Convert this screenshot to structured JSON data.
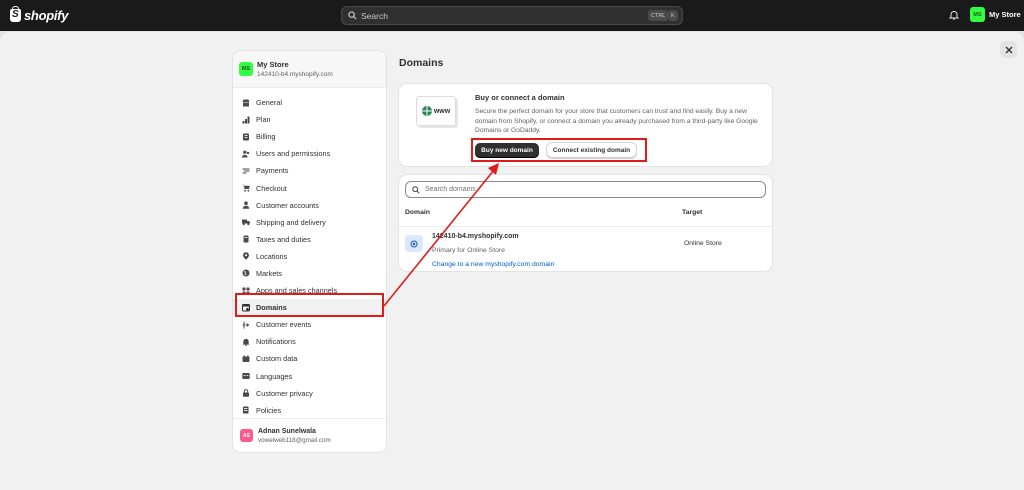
{
  "topbar": {
    "logo_text": "shopify",
    "search_placeholder": "Search",
    "kbd_ctrl": "CTRL",
    "kbd_k": "K",
    "store_initials": "MS",
    "store_label": "My Store"
  },
  "sidebar": {
    "store_initials": "MS",
    "store_name": "My Store",
    "store_url": "142410-b4.myshopify.com",
    "items": [
      {
        "label": "General",
        "icon": "store-icon"
      },
      {
        "label": "Plan",
        "icon": "chart-icon"
      },
      {
        "label": "Billing",
        "icon": "billing-icon"
      },
      {
        "label": "Users and permissions",
        "icon": "users-icon"
      },
      {
        "label": "Payments",
        "icon": "payments-icon"
      },
      {
        "label": "Checkout",
        "icon": "cart-icon"
      },
      {
        "label": "Customer accounts",
        "icon": "person-icon"
      },
      {
        "label": "Shipping and delivery",
        "icon": "truck-icon"
      },
      {
        "label": "Taxes and duties",
        "icon": "taxes-icon"
      },
      {
        "label": "Locations",
        "icon": "location-icon"
      },
      {
        "label": "Markets",
        "icon": "globe-icon"
      },
      {
        "label": "Apps and sales channels",
        "icon": "apps-icon"
      },
      {
        "label": "Domains",
        "icon": "domains-icon"
      },
      {
        "label": "Customer events",
        "icon": "events-icon"
      },
      {
        "label": "Notifications",
        "icon": "bell-icon"
      },
      {
        "label": "Custom data",
        "icon": "database-icon"
      },
      {
        "label": "Languages",
        "icon": "language-icon"
      },
      {
        "label": "Customer privacy",
        "icon": "lock-icon"
      },
      {
        "label": "Policies",
        "icon": "policy-icon"
      }
    ],
    "active_index": 12,
    "user_initials": "AS",
    "user_name": "Adnan Sunelwala",
    "user_email": "vowelweb118@gmail.com"
  },
  "main": {
    "title": "Domains",
    "buy_card": {
      "image_text": "www",
      "title": "Buy or connect a domain",
      "description": "Secure the perfect domain for your store that customers can trust and find easily. Buy a new domain from Shopify, or connect a domain you already purchased from a third-party like Google Domains or GoDaddy.",
      "buy_button": "Buy new domain",
      "connect_button": "Connect existing domain"
    },
    "table": {
      "search_placeholder": "Search domains",
      "col_domain": "Domain",
      "col_target": "Target",
      "rows": [
        {
          "domain": "142410-b4.myshopify.com",
          "subtitle": "Primary for Online Store",
          "link": "Change to a new myshopify.com domain",
          "target": "Online Store"
        }
      ]
    }
  },
  "colors": {
    "annotation": "#e01b1b",
    "link": "#005bd3",
    "store_avatar": "#36fc41",
    "user_avatar": "#fd5a8c"
  }
}
